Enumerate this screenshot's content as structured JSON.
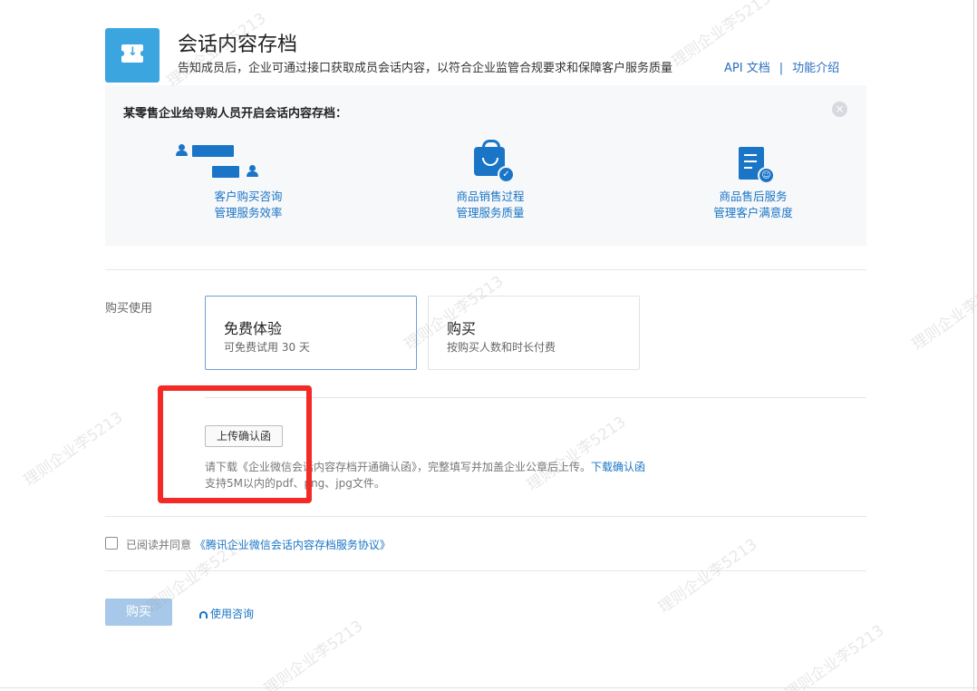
{
  "header": {
    "title": "会话内容存档",
    "description": "告知成员后，企业可通过接口获取成员会话内容，以符合企业监管合规要求和保障客户服务质量",
    "links": [
      "API 文档",
      "功能介绍"
    ],
    "link_separator": "|"
  },
  "intro": {
    "title": "某零售企业给导购人员开启会话内容存档：",
    "close_symbol": "×",
    "features": [
      {
        "line1": "客户购买咨询",
        "line2": "管理服务效率",
        "icon": "chat-people-icon"
      },
      {
        "line1": "商品销售过程",
        "line2": "管理服务质量",
        "icon": "shopping-bag-icon"
      },
      {
        "line1": "商品售后服务",
        "line2": "管理客户满意度",
        "icon": "document-smile-icon"
      }
    ]
  },
  "purchase": {
    "label": "购买使用",
    "options": [
      {
        "title": "免费体验",
        "subtitle": "可免费试用 30 天",
        "selected": true
      },
      {
        "title": "购买",
        "subtitle": "按购买人数和时长付费",
        "selected": false
      }
    ]
  },
  "upload": {
    "button_label": "上传确认函",
    "hint_prefix": "请下载《企业微信会话内容存档开通确认函》，完整填写并加盖企业公章后上传。",
    "hint_link": "下载确认函",
    "note": "支持5M以内的pdf、png、jpg文件。"
  },
  "agreement": {
    "text": "已阅读并同意",
    "link": "《腾讯企业微信会话内容存档服务协议》",
    "checked": false
  },
  "actions": {
    "buy_label": "购买",
    "consult_label": "使用咨询"
  },
  "watermark": "理则企业李5213",
  "colors": {
    "accent": "#1a75c6",
    "app_icon": "#3ba5e0",
    "annotation_box": "#f32a26",
    "buy_disabled": "#a7c8e8"
  }
}
